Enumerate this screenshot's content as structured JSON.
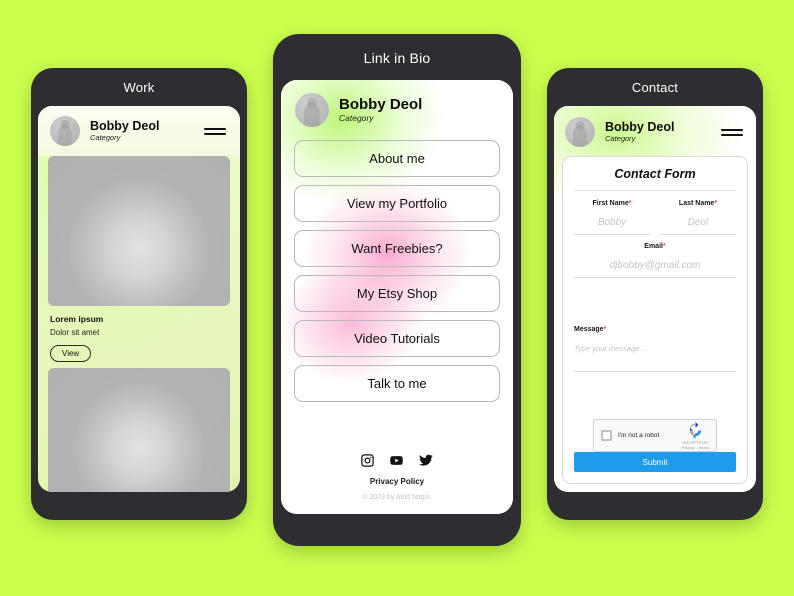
{
  "theme": {
    "background": "#caff4d",
    "phone_frame": "#2e2e32",
    "accent_green": "#96f028",
    "accent_pink": "#f778b4",
    "submit_blue": "#1f9beb",
    "required_star": "#e0457b"
  },
  "profile": {
    "name": "Bobby Deol",
    "category": "Category",
    "avatar_icon": "user-avatar-placeholder",
    "menu_icon": "hamburger-menu-icon"
  },
  "work_screen": {
    "title": "Work",
    "items": [
      {
        "image_alt": "portfolio-image-placeholder",
        "caption_title": "Lorem ipsum",
        "caption_sub": "Dolor sit amet",
        "button_label": "View"
      },
      {
        "image_alt": "portfolio-image-placeholder"
      }
    ]
  },
  "bio_screen": {
    "title": "Link in Bio",
    "links": [
      {
        "label": "About me"
      },
      {
        "label": "View my Portfolio"
      },
      {
        "label": "Want Freebies?"
      },
      {
        "label": "My Etsy Shop"
      },
      {
        "label": "Video Tutorials"
      },
      {
        "label": "Talk to me"
      }
    ],
    "socials": [
      {
        "name": "instagram-icon"
      },
      {
        "name": "youtube-icon"
      },
      {
        "name": "twitter-icon"
      }
    ],
    "privacy_label": "Privacy Policy",
    "copyright": "© 2023 by Abid Naqvi."
  },
  "contact_screen": {
    "title": "Contact",
    "form_title": "Contact Form",
    "required_marker": "*",
    "fields": {
      "first_name": {
        "label": "First Name",
        "placeholder": "Bobby",
        "value": ""
      },
      "last_name": {
        "label": "Last Name",
        "placeholder": "Deol",
        "value": ""
      },
      "email": {
        "label": "Email",
        "placeholder": "djbobby@gmail.com",
        "value": ""
      },
      "message": {
        "label": "Message",
        "placeholder": "Type your message...",
        "value": ""
      }
    },
    "recaptcha": {
      "label": "I'm not a robot",
      "brand": "reCAPTCHA",
      "terms": "Privacy - Terms",
      "checked": false
    },
    "submit_label": "Submit"
  }
}
